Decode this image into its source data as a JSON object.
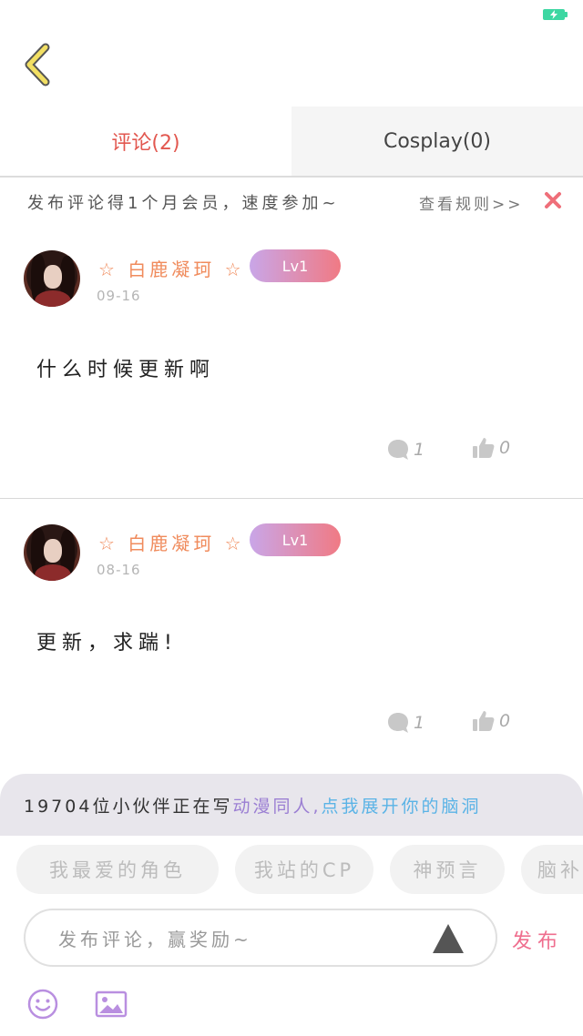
{
  "tabs": [
    {
      "label": "评论(2)",
      "active": true
    },
    {
      "label": "Cosplay(0)",
      "active": false
    }
  ],
  "notice": {
    "text": "发布评论得1个月会员，速度参加~",
    "link": "查看规则>>"
  },
  "comments": [
    {
      "username": "☆ 白鹿凝珂 ☆",
      "level": "Lv1",
      "date": "09-16",
      "text": "什么时候更新啊",
      "replies": "1",
      "likes": "0"
    },
    {
      "username": "☆ 白鹿凝珂 ☆",
      "level": "Lv1",
      "date": "08-16",
      "text": "更新，求踹!",
      "replies": "1",
      "likes": "0"
    }
  ],
  "promo": {
    "part1": "19704位小伙伴正在写",
    "part2": "动漫同人,",
    "part3": "点我展开你的脑洞"
  },
  "chips": [
    "我最爱的角色",
    "我站的CP",
    "神预言",
    "脑补"
  ],
  "input": {
    "placeholder": "发布评论，赢奖励~"
  },
  "publish_label": "发布",
  "colors": {
    "accent_red": "#e2574f",
    "username_orange": "#f08b5c",
    "publish_pink": "#ef6e8e",
    "promo_purple": "#9b7fd3",
    "promo_blue": "#5ab3e6",
    "battery_green": "#3dd7a2"
  },
  "icons": {
    "back": "chevron-left-icon",
    "close": "close-icon",
    "reply": "comment-bubble-icon",
    "like": "thumbs-up-icon",
    "send": "triangle-icon",
    "emoji": "smiley-icon",
    "image": "image-icon"
  }
}
